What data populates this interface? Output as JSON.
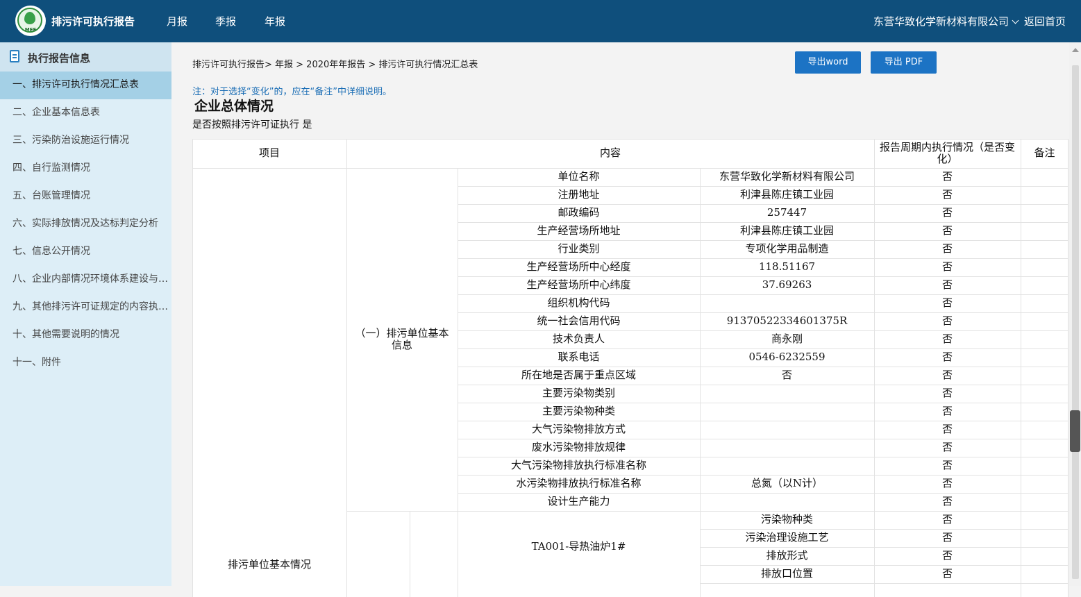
{
  "app": {
    "logo_text": "MEE",
    "title": "排污许可执行报告",
    "nav": [
      "月报",
      "季报",
      "年报"
    ],
    "company": "东营华致化学新材料有限公司",
    "home": "返回首页"
  },
  "sidebar": {
    "title": "执行报告信息",
    "items": [
      "一、排污许可执行情况汇总表",
      "二、企业基本信息表",
      "三、污染防治设施运行情况",
      "四、自行监测情况",
      "五、台账管理情况",
      "六、实际排放情况及达标判定分析",
      "七、信息公开情况",
      "八、企业内部情况环境体系建设与运行情况",
      "九、其他排污许可证规定的内容执行情况",
      "十、其他需要说明的情况",
      "十一、附件"
    ]
  },
  "main": {
    "breadcrumb": "排污许可执行报告> 年报 > 2020年年报告 > 排污许可执行情况汇总表",
    "export_word": "导出word",
    "export_pdf": "导出 PDF",
    "note": "注：对于选择“变化”的，应在“备注”中详细说明。",
    "section_title": "企业总体情况",
    "subtitle": "是否按照排污许可证执行 是"
  },
  "table": {
    "headers": [
      "项目",
      "内容",
      "报告周期内执行情况（是否变化）",
      "备注"
    ],
    "group_label": "排污单位基本情况",
    "subgroup_label": "（一）排污单位基本信息",
    "rows": [
      {
        "item": "单位名称",
        "value": "东营华致化学新材料有限公司",
        "changed": "否",
        "remark": ""
      },
      {
        "item": "注册地址",
        "value": "利津县陈庄镇工业园",
        "changed": "否",
        "remark": ""
      },
      {
        "item": "邮政编码",
        "value": "257447",
        "changed": "否",
        "remark": ""
      },
      {
        "item": "生产经营场所地址",
        "value": "利津县陈庄镇工业园",
        "changed": "否",
        "remark": ""
      },
      {
        "item": "行业类别",
        "value": "专项化学用品制造",
        "changed": "否",
        "remark": ""
      },
      {
        "item": "生产经营场所中心经度",
        "value": "118.51167",
        "changed": "否",
        "remark": ""
      },
      {
        "item": "生产经营场所中心纬度",
        "value": "37.69263",
        "changed": "否",
        "remark": ""
      },
      {
        "item": "组织机构代码",
        "value": "",
        "changed": "否",
        "remark": ""
      },
      {
        "item": "统一社会信用代码",
        "value": "91370522334601375R",
        "changed": "否",
        "remark": ""
      },
      {
        "item": "技术负责人",
        "value": "商永刚",
        "changed": "否",
        "remark": ""
      },
      {
        "item": "联系电话",
        "value": "0546-6232559",
        "changed": "否",
        "remark": ""
      },
      {
        "item": "所在地是否属于重点区域",
        "value": "否",
        "changed": "否",
        "remark": ""
      },
      {
        "item": "主要污染物类别",
        "value": "",
        "changed": "否",
        "remark": ""
      },
      {
        "item": "主要污染物种类",
        "value": "",
        "changed": "否",
        "remark": ""
      },
      {
        "item": "大气污染物排放方式",
        "value": "",
        "changed": "否",
        "remark": ""
      },
      {
        "item": "废水污染物排放规律",
        "value": "",
        "changed": "否",
        "remark": ""
      },
      {
        "item": "大气污染物排放执行标准名称",
        "value": "",
        "changed": "否",
        "remark": ""
      },
      {
        "item": "水污染物排放执行标准名称",
        "value": "总氮（以N计）",
        "changed": "否",
        "remark": ""
      },
      {
        "item": "设计生产能力",
        "value": "",
        "changed": "否",
        "remark": ""
      }
    ],
    "facility": {
      "name": "TA001-导热油炉1#",
      "rows": [
        {
          "item": "污染物种类",
          "changed": "否",
          "remark": ""
        },
        {
          "item": "污染治理设施工艺",
          "changed": "否",
          "remark": ""
        },
        {
          "item": "排放形式",
          "changed": "否",
          "remark": ""
        },
        {
          "item": "排放口位置",
          "changed": "否",
          "remark": ""
        }
      ]
    }
  }
}
